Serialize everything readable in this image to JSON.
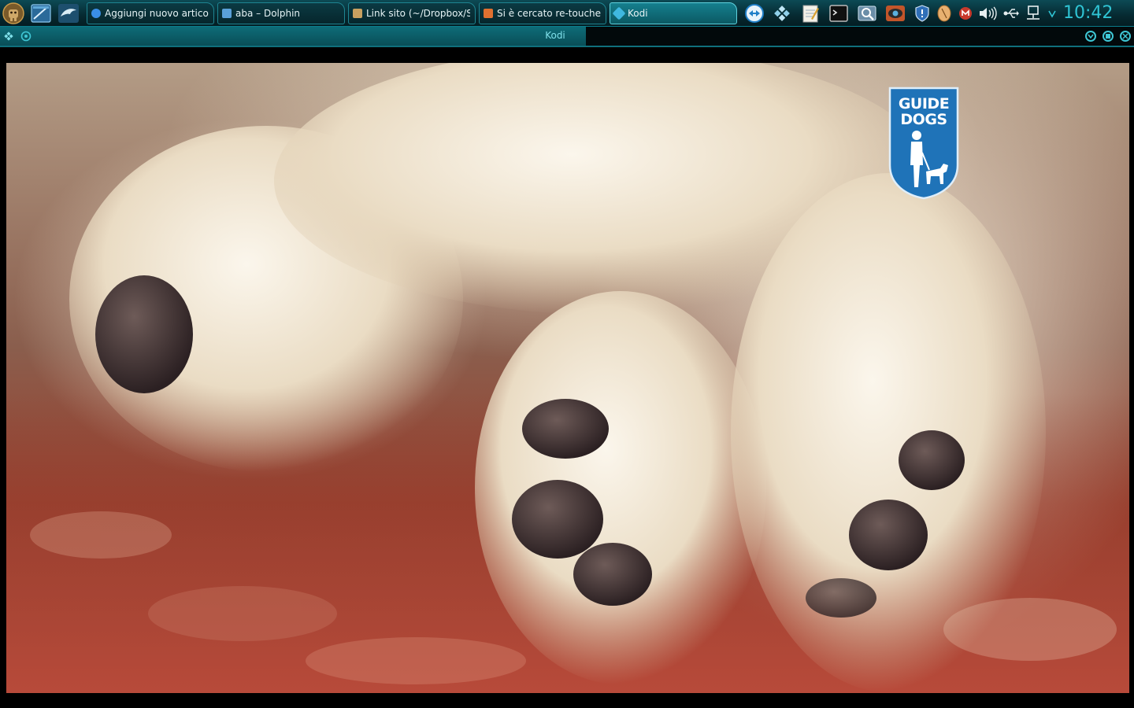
{
  "taskbar": {
    "tasks": [
      {
        "label": "Aggiungi nuovo articolo",
        "icon": "globe-icon",
        "color": "#3a8ee6"
      },
      {
        "label": "aba – Dolphin",
        "icon": "folder-icon",
        "color": "#5aa0d8"
      },
      {
        "label": "Link sito (~/Dropbox/Siti)",
        "icon": "scissors-icon",
        "color": "#c8a060"
      },
      {
        "label": "Si è cercato re-touched",
        "icon": "browser-icon",
        "color": "#e07030"
      },
      {
        "label": "Kodi",
        "icon": "kodi-icon",
        "color": "#3fb8e0"
      }
    ],
    "clock": "10:42"
  },
  "window": {
    "title": "Kodi"
  },
  "video": {
    "logo_line1": "GUIDE",
    "logo_line2": "DOGS"
  },
  "colors": {
    "accent": "#2fc4d4",
    "taskbar_bg": "#062a31",
    "active_task": "#157f8e",
    "logo_blue": "#1f73b8"
  }
}
